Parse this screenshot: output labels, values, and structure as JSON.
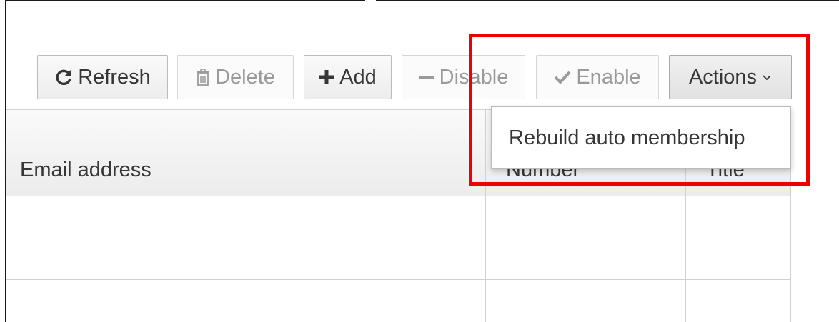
{
  "toolbar": {
    "refresh_label": "Refresh",
    "delete_label": "Delete",
    "add_label": "Add",
    "disable_label": "Disable",
    "enable_label": "Enable",
    "actions_label": "Actions"
  },
  "actions_menu": {
    "items": [
      "Rebuild auto membership"
    ]
  },
  "table": {
    "headers": [
      "Email address",
      "Number",
      "Title"
    ],
    "rows": [
      [
        "",
        "",
        ""
      ],
      [
        "",
        "",
        ""
      ]
    ]
  },
  "icons": {
    "refresh": "refresh-icon",
    "delete": "trash-icon",
    "add": "plus-icon",
    "disable": "minus-icon",
    "enable": "check-icon",
    "actions": "chevron-down-icon"
  },
  "colors": {
    "highlight": "#ee0000",
    "text": "#363636",
    "disabled_text": "#9a9a9a",
    "border": "#bbbbbb"
  }
}
